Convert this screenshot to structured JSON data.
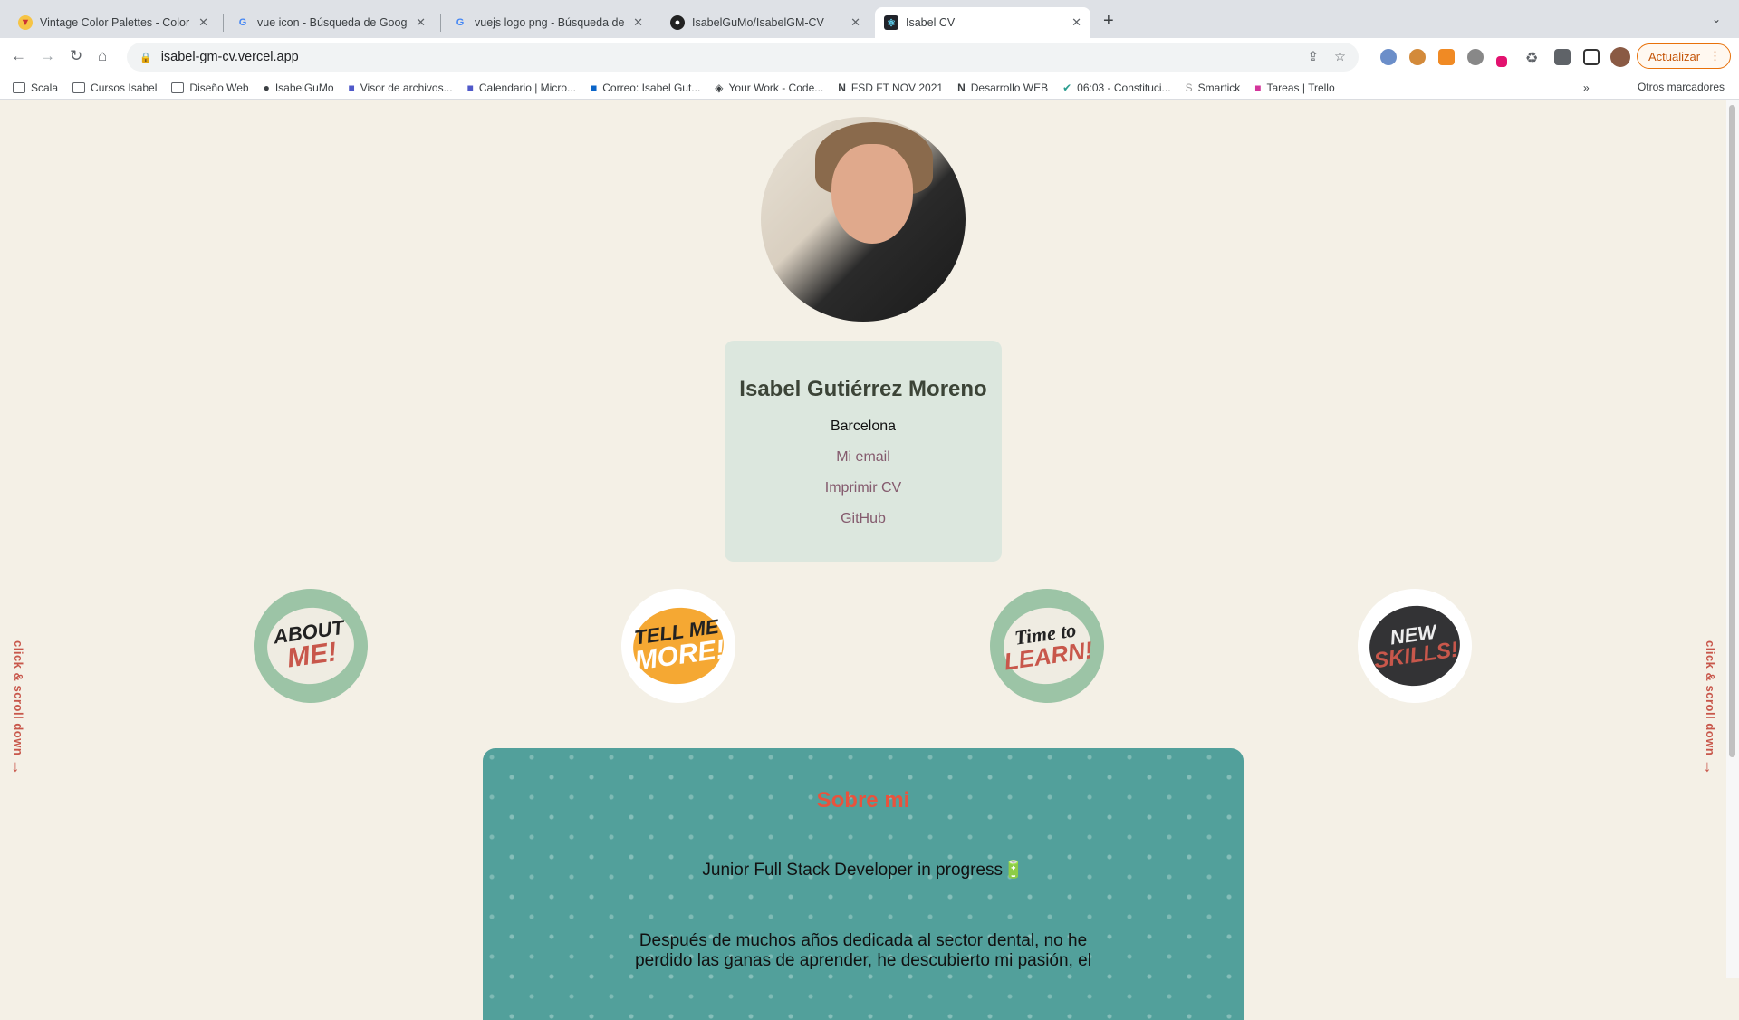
{
  "browser": {
    "tabs": [
      {
        "title": "Vintage Color Palettes - Color Hunt",
        "icon": "color-hunt-icon"
      },
      {
        "title": "vue icon - Búsqueda de Google",
        "icon": "google-icon"
      },
      {
        "title": "vuejs logo png - Búsqueda de Google",
        "icon": "google-icon"
      },
      {
        "title": "IsabelGuMo/IsabelGM-CV",
        "icon": "github-icon"
      },
      {
        "title": "Isabel CV",
        "icon": "react-icon",
        "active": true
      }
    ],
    "url": "isabel-gm-cv.vercel.app",
    "update_label": "Actualizar",
    "bookmarks": [
      "Scala",
      "Cursos Isabel",
      "Diseño Web",
      "IsabelGuMo",
      "Visor de archivos...",
      "Calendario | Micro...",
      "Correo: Isabel Gut...",
      "Your Work - Code...",
      "FSD FT NOV 2021",
      "Desarrollo WEB",
      "06:03 - Constituci...",
      "Smartick",
      "Tareas | Trello"
    ],
    "other_bookmarks": "Otros marcadores",
    "more": "»"
  },
  "profile": {
    "name": "Isabel Gutiérrez Moreno",
    "city": "Barcelona",
    "links": [
      "Mi email",
      "Imprimir CV",
      "GitHub"
    ]
  },
  "nav_bubbles": [
    {
      "line1": "ABOUT",
      "line2": "ME!",
      "bg": "#9cc4a6",
      "c1": "#222",
      "c2": "#c8574b"
    },
    {
      "line1": "TELL ME",
      "line2": "MORE!",
      "bg": "#f5a833",
      "c1": "#222",
      "c2": "#ffffff"
    },
    {
      "line1": "Time to",
      "line2": "LEARN!",
      "bg": "#9cc4a6",
      "c1": "#222",
      "c2": "#c8574b"
    },
    {
      "line1": "NEW",
      "line2": "SKILLS!",
      "bg": "#333335",
      "c1": "#eee",
      "c2": "#c8574b"
    }
  ],
  "side_hint": "click & scroll down",
  "about": {
    "title": "Sobre mi",
    "subtitle": "Junior Full Stack Developer in progress🔋",
    "paragraph": "Después de muchos años dedicada al sector dental, no he perdido las ganas de aprender, he descubierto mi pasión, el"
  },
  "colors": {
    "background": "#f4f0e6",
    "card": "#dce7de",
    "section": "#52a09b",
    "accent": "#e8533d",
    "link": "#845a6d"
  }
}
